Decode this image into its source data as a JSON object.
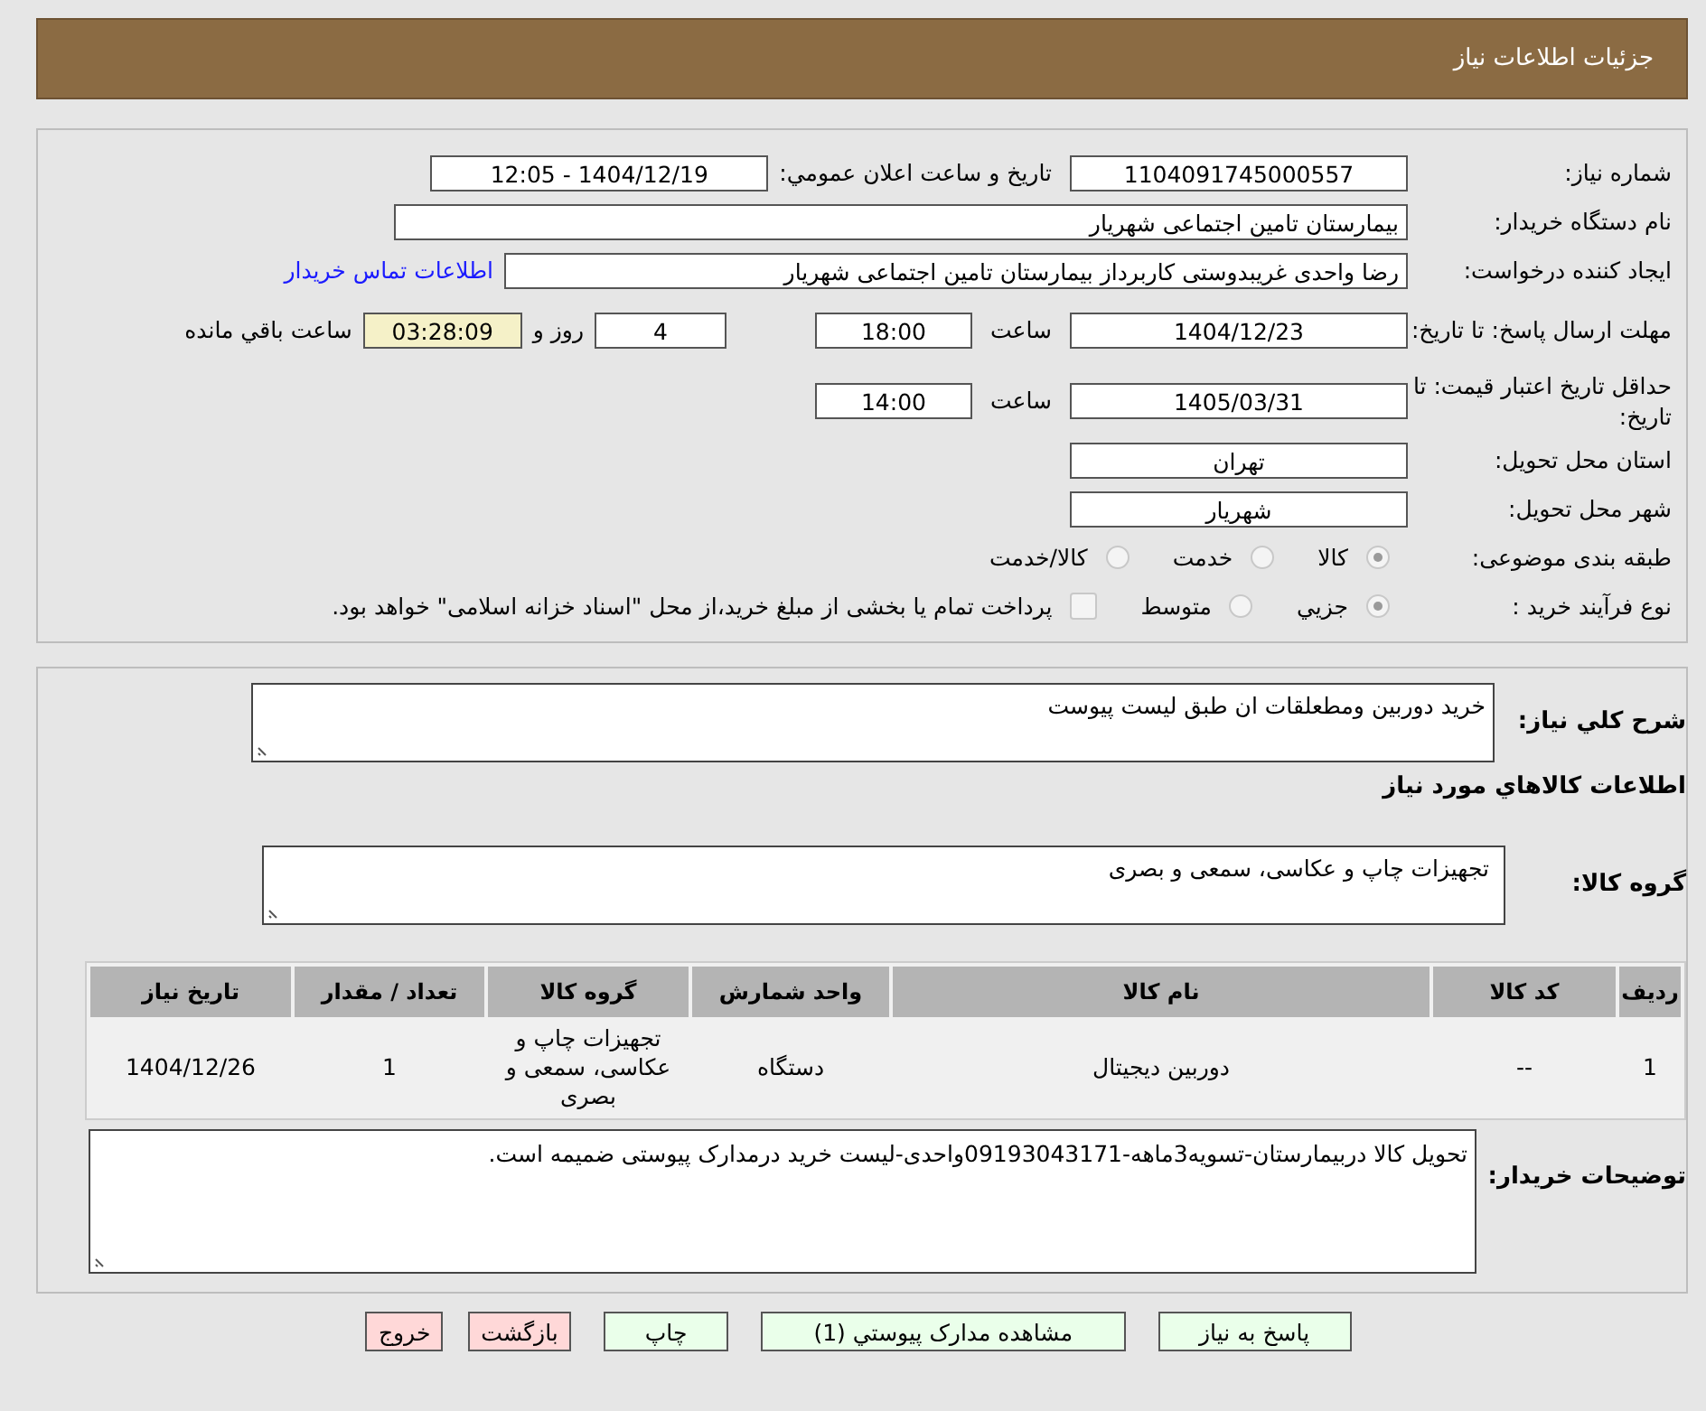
{
  "header": {
    "title": "جزئیات اطلاعات نیاز"
  },
  "need_number": {
    "label": "شماره نیاز:",
    "value": "1104091745000557"
  },
  "announce": {
    "label": "تاریخ و ساعت اعلان عمومي:",
    "value": "1404/12/19 - 12:05"
  },
  "buyer": {
    "label": "نام دستگاه خريدار:",
    "value": "بیمارستان تامین اجتماعی شهریار"
  },
  "requester": {
    "label": "ایجاد کننده درخواست:",
    "value": "رضا واحدی غریبدوستی کاربرداز بیمارستان تامین اجتماعی شهریار",
    "link": "اطلاعات تماس خریدار"
  },
  "deadline": {
    "label": "مهلت ارسال پاسخ: تا تاریخ:",
    "date": "1404/12/23",
    "time_label": "ساعت",
    "time": "18:00",
    "days": "4",
    "days_label": "روز و",
    "remaining": "03:28:09",
    "remaining_label": "ساعت باقي مانده"
  },
  "validity": {
    "label": "حداقل تاریخ اعتبار قیمت: تا تاریخ:",
    "date": "1405/03/31",
    "time_label": "ساعت",
    "time": "14:00"
  },
  "province": {
    "label": "استان محل تحویل:",
    "value": "تهران"
  },
  "city": {
    "label": "شهر محل تحویل:",
    "value": "شهریار"
  },
  "category": {
    "label": "طبقه بندی موضوعی:",
    "options": [
      {
        "label": "کالا",
        "selected": true
      },
      {
        "label": "خدمت",
        "selected": false
      },
      {
        "label": "کالا/خدمت",
        "selected": false
      }
    ]
  },
  "process": {
    "label": "نوع فرآیند خرید :",
    "options": [
      {
        "label": "جزيي",
        "selected": true
      },
      {
        "label": "متوسط",
        "selected": false
      }
    ],
    "payment": {
      "checked": false,
      "text": "پرداخت تمام یا بخشی از مبلغ خرید،از محل \"اسناد خزانه اسلامی\" خواهد بود."
    }
  },
  "summary": {
    "label": "شرح کلي نیاز:",
    "value": "خرید دوربین ومطعلقات ان طبق لیست پیوست"
  },
  "goods_title": "اطلاعات کالاهاي مورد نیاز",
  "goods_group": {
    "label": "گروه کالا:",
    "value": "تجهیزات چاپ و عکاسی، سمعی و بصری"
  },
  "table": {
    "columns": [
      "ردیف",
      "کد کالا",
      "نام کالا",
      "واحد شمارش",
      "گروه کالا",
      "تعداد / مقدار",
      "تاریخ نیاز"
    ],
    "rows": [
      [
        "1",
        "--",
        "دوربین دیجیتال",
        "دستگاه",
        "تجهیزات چاپ و عکاسی، سمعی و بصری",
        "1",
        "1404/12/26"
      ]
    ]
  },
  "notes": {
    "label": "توضیحات خریدار:",
    "value": "تحویل کالا دربیمارستان-تسویه3ماهه-09193043171واحدی-لیست خرید درمدارک پیوستی ضمیمه است."
  },
  "buttons": [
    {
      "label": "پاسخ به نیاز",
      "kind": "normal"
    },
    {
      "label": "مشاهده مدارک پیوستي (1)",
      "kind": "normal"
    },
    {
      "label": "چاپ",
      "kind": "normal"
    },
    {
      "label": "بازگشت",
      "kind": "danger"
    },
    {
      "label": "خروج",
      "kind": "danger"
    }
  ]
}
